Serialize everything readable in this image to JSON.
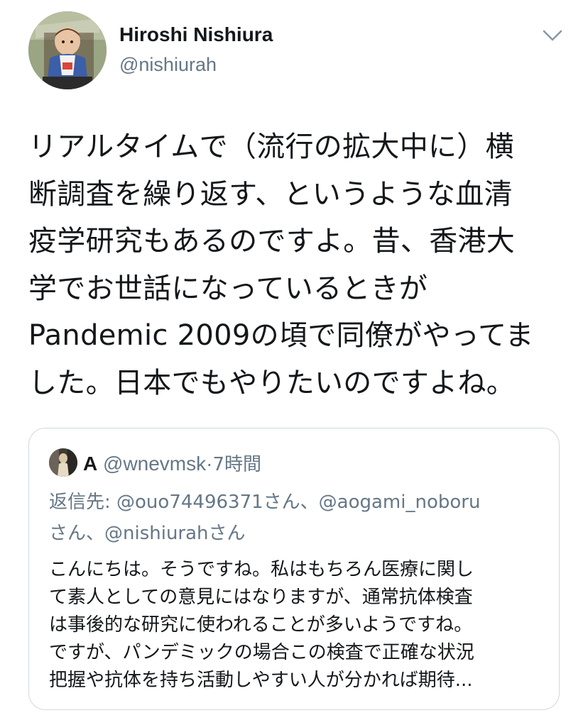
{
  "author": {
    "name": "Hiroshi Nishiura",
    "handle": "@nishiurah"
  },
  "tweet_text_lines": [
    "リアルタイムで（流行の拡大中に）横",
    "断調査を繰り返す、というような血清",
    "疫学研究もあるのですよ。昔、香港大",
    "学でお世話になっているときが",
    "Pandemic 2009の頃で同僚がやってま",
    "した。日本でもやりたいのですよね。"
  ],
  "quoted_tweet": {
    "name": "A",
    "handle": "@wnevmsk",
    "separator": "·",
    "time": "7時間",
    "reply_lines": [
      "返信先: @ouo74496371さん、@aogami_noboru",
      "さん、@nishiurahさん"
    ],
    "text_lines": [
      "こんにちは。そうですね。私はもちろん医療に関し",
      "て素人としての意見にはなりますが、通常抗体検査",
      "は事後的な研究に使われることが多いようですね。",
      "ですが、パンデミックの場合この検査で正確な状況",
      "把握や抗体を持ち活動しやすい人が分かれば期待..."
    ]
  },
  "icons": {
    "menu": "chevron-down-icon"
  },
  "colors": {
    "text": "#14171a",
    "secondary": "#657786",
    "border": "#cfd9de"
  }
}
